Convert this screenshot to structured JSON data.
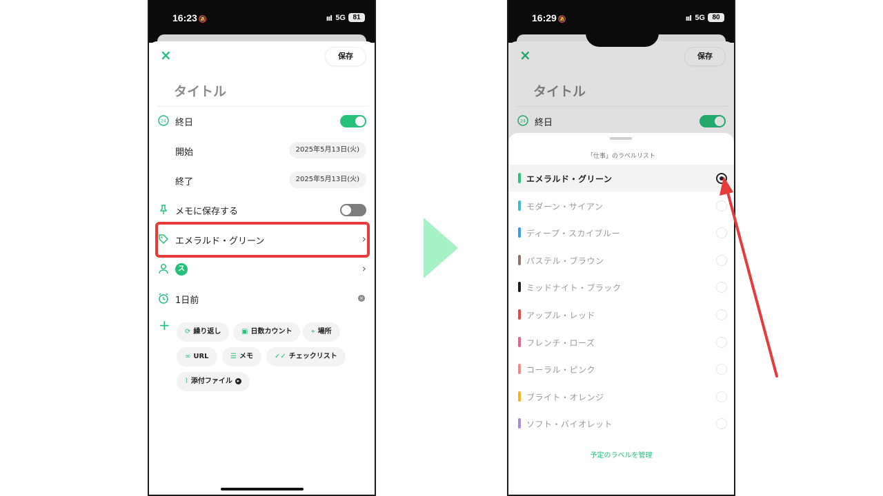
{
  "left_phone": {
    "status": {
      "time": "16:23",
      "bell": "🔕",
      "signal": "ııl",
      "network": "5G",
      "battery": "81"
    },
    "header": {
      "close_icon": "×",
      "save_label": "保存"
    },
    "title_placeholder": "タイトル",
    "all_day": {
      "label": "終日",
      "on": true
    },
    "start": {
      "label": "開始",
      "date": "2025年5月13日(火)"
    },
    "end": {
      "label": "終了",
      "date": "2025年5月13日(火)"
    },
    "memo": {
      "label": "メモに保存する",
      "on": false
    },
    "label_row": {
      "label": "エメラルド・グリーン",
      "chevron": "›"
    },
    "member": {
      "initial": "ス",
      "chevron": "›"
    },
    "reminder": {
      "label": "1日前",
      "badge": "×"
    },
    "chips": {
      "repeat": "繰り返し",
      "day_count": "日数カウント",
      "place": "場所",
      "url": "URL",
      "memo": "メモ",
      "checklist": "チェックリスト",
      "attachment": "添付ファイル"
    }
  },
  "right_phone": {
    "status": {
      "time": "16:29",
      "bell": "🔕",
      "signal": "ııl",
      "network": "5G",
      "battery": "80"
    },
    "header": {
      "close_icon": "×",
      "save_label": "保存"
    },
    "title_placeholder": "タイトル",
    "all_day": {
      "label": "終日"
    },
    "sheet_title": "「仕事」のラベルリスト",
    "labels": [
      {
        "name": "エメラルド・グリーン",
        "color": "#2ec27e",
        "selected": true
      },
      {
        "name": "モダーン・サイアン",
        "color": "#3ec0cf",
        "selected": false
      },
      {
        "name": "ディープ・スカイブルー",
        "color": "#3a9be8",
        "selected": false
      },
      {
        "name": "パステル・ブラウン",
        "color": "#8d7468",
        "selected": false
      },
      {
        "name": "ミッドナイト・ブラック",
        "color": "#1c1c1c",
        "selected": false
      },
      {
        "name": "アップル・レッド",
        "color": "#e04a4a",
        "selected": false
      },
      {
        "name": "フレンチ・ローズ",
        "color": "#e9628e",
        "selected": false
      },
      {
        "name": "コーラル・ピンク",
        "color": "#f28a8a",
        "selected": false
      },
      {
        "name": "ブライト・オレンジ",
        "color": "#f5b51e",
        "selected": false
      },
      {
        "name": "ソフト・バイオレット",
        "color": "#a98ad6",
        "selected": false
      }
    ],
    "manage_link": "予定のラベルを管理"
  },
  "colors": {
    "accent": "#27c07a",
    "highlight": "#e63b3b",
    "arrow": "#a6f2c6"
  }
}
